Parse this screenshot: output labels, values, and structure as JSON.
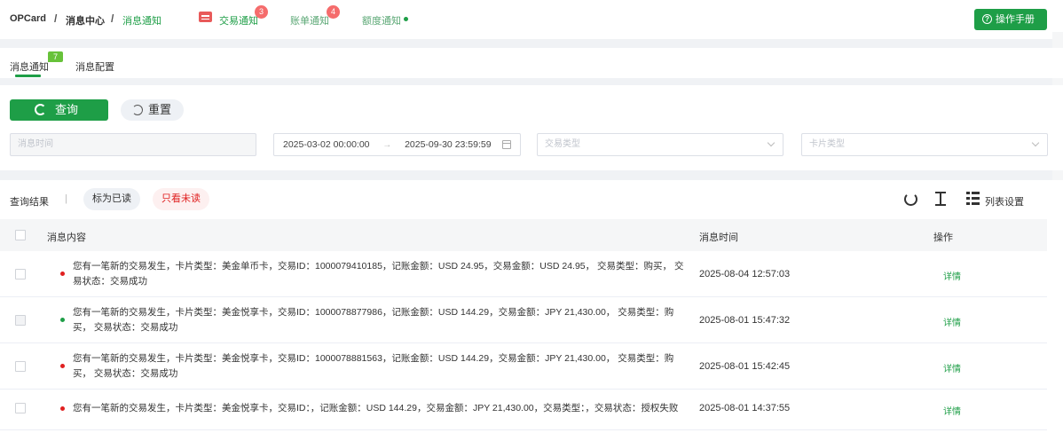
{
  "breadcrumb": {
    "root": "OPCard",
    "sep1": "/",
    "level1": "消息中心",
    "sep2": "/",
    "current": "消息通知"
  },
  "topnav": {
    "items": [
      {
        "label": "交易通知",
        "badge": "3"
      },
      {
        "label": "账单通知",
        "badge": "4"
      },
      {
        "label": "额度通知"
      }
    ]
  },
  "manual_button": "操作手册",
  "manual_icon": "?",
  "tabs": [
    {
      "label": "消息通知",
      "count": "7"
    },
    {
      "label": "消息配置"
    }
  ],
  "filters": {
    "query_label": "查询",
    "reset_label": "重置",
    "message_time_placeholder": "消息时间",
    "date_start": "2025-03-02 00:00:00",
    "date_arrow": "→",
    "date_end": "2025-09-30 23:59:59",
    "trade_type_placeholder": "交易类型",
    "card_type_placeholder": "卡片类型"
  },
  "results": {
    "title": "查询结果",
    "divider": "|",
    "mark_read": "标为已读",
    "unread_only": "只看未读",
    "list_settings": "列表设置"
  },
  "table": {
    "headers": {
      "content": "消息内容",
      "time": "消息时间",
      "action": "操作"
    },
    "rows": [
      {
        "status_color": "#e02020",
        "line1": "您有一笔新的交易发生，卡片类型：美金单币卡，交易ID：1000079410185，记账金额：USD 24.95，交易金额：USD 24.95， 交易类型：购买， 交",
        "line2": "易状态：交易成功",
        "time": "2025-08-04 12:57:03",
        "action": "详情"
      },
      {
        "status_color": "#1e9e47",
        "line1": "您有一笔新的交易发生，卡片类型：美金悦享卡，交易ID：1000078877986，记账金额：USD 144.29，交易金额：JPY 21,430.00， 交易类型：购",
        "line2": "买， 交易状态：交易成功",
        "time": "2025-08-01 15:47:32",
        "action": "详情"
      },
      {
        "status_color": "#e02020",
        "line1": "您有一笔新的交易发生，卡片类型：美金悦享卡，交易ID：1000078881563，记账金额：USD 144.29，交易金额：JPY 21,430.00， 交易类型：购",
        "line2": "买， 交易状态：交易成功",
        "time": "2025-08-01 15:42:45",
        "action": "详情"
      },
      {
        "status_color": "#e02020",
        "line1": "您有一笔新的交易发生，卡片类型：美金悦享卡，交易ID：，记账金额：USD 144.29，交易金额：JPY 21,430.00，交易类型：，交易状态：授权失败",
        "line2": "",
        "time": "2025-08-01 14:37:55",
        "action": "详情"
      }
    ]
  },
  "colors": {
    "brand_green": "#1e9e47",
    "badge_red": "#f56c6c",
    "unread_red": "#e02020"
  }
}
